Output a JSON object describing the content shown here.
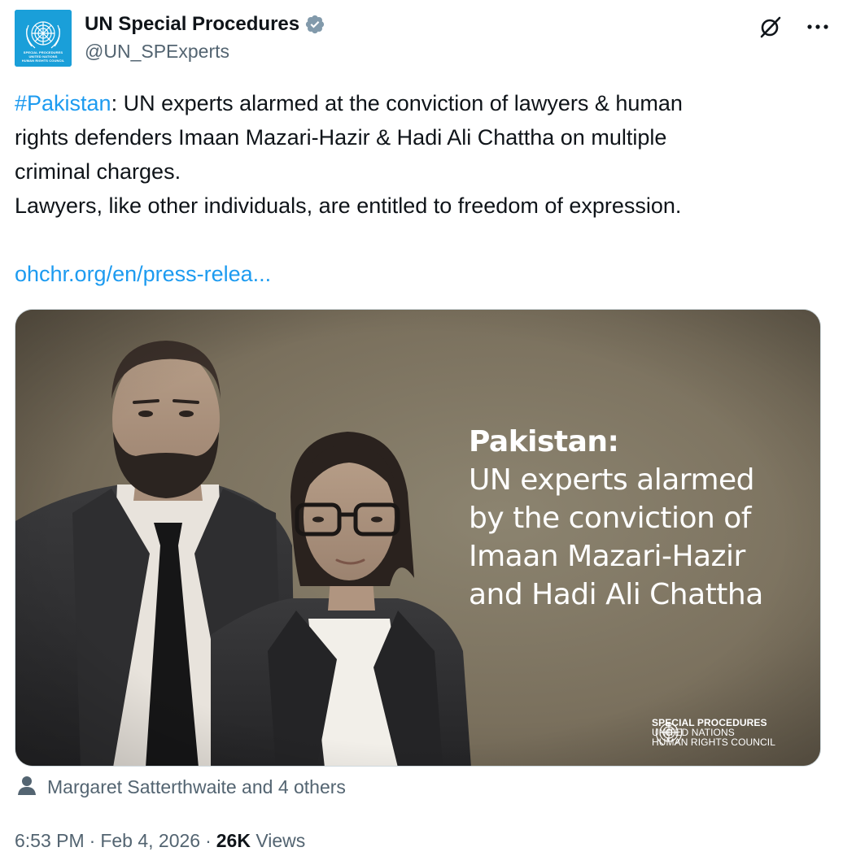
{
  "account": {
    "display_name": "UN Special Procedures",
    "handle": "@UN_SPExperts",
    "avatar_caption": "SPECIAL PROCEDURES\nUNITED NATIONS\nHUMAN RIGHTS COUNCIL",
    "avatar_color": "#1a9fd9",
    "verified_badge_color": "#829aab"
  },
  "post": {
    "hashtag": "#Pakistan",
    "line1_rest": ": UN experts alarmed at the conviction of lawyers & human",
    "line2": "rights defenders Imaan Mazari-Hazir & Hadi Ali Chattha on multiple",
    "line3": "criminal charges.",
    "line4": "Lawyers, like other individuals, are entitled to freedom of expression.",
    "link": "ohchr.org/en/press-relea..."
  },
  "media": {
    "heading": "Pakistan:",
    "body_lines": [
      "UN experts alarmed",
      "by the conviction of",
      "Imaan Mazari-Hazir",
      "and Hadi Ali Chattha"
    ],
    "logo": {
      "line1": "SPECIAL PROCEDURES",
      "line2": "UNITED NATIONS",
      "line3": "HUMAN RIGHTS COUNCIL"
    }
  },
  "tagged": {
    "text": "Margaret Satterthwaite and 4 others",
    "icon": "person-icon"
  },
  "meta": {
    "time": "6:53 PM",
    "date": "Feb 4, 2026",
    "views_count": "26K",
    "views_label": "Views",
    "separator": "·"
  },
  "icons": {
    "grok": "grok-icon",
    "more": "more-icon",
    "verified": "verified-badge-icon"
  },
  "colors": {
    "text_primary": "#0f1419",
    "text_secondary": "#536471",
    "link": "#1d9bf0"
  }
}
